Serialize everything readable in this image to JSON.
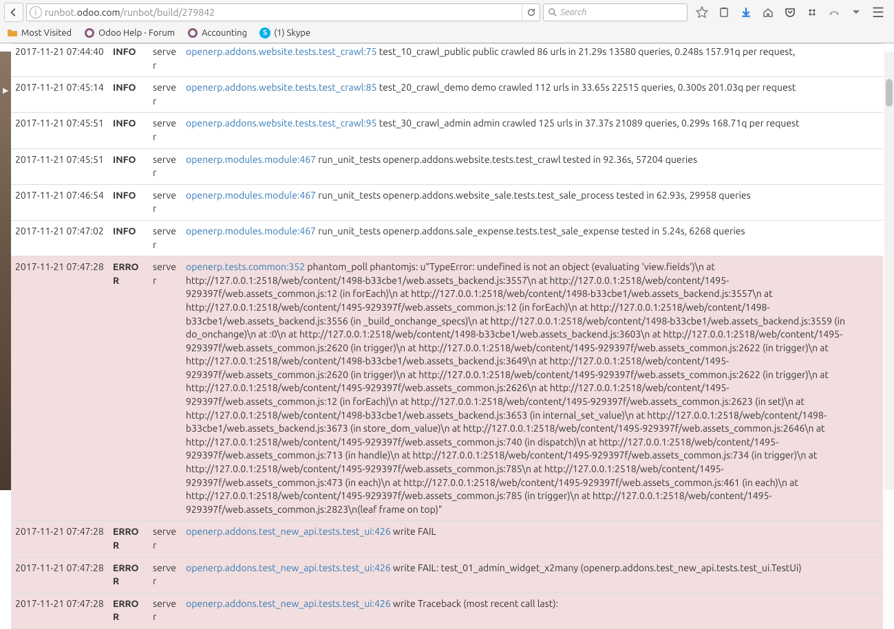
{
  "browser": {
    "url_prefix": "runbot.",
    "url_host": "odoo.com",
    "url_path": "/runbot/build/279842",
    "search_placeholder": "Search"
  },
  "bookmarks": [
    {
      "label": "Most Visited",
      "icon": "folder"
    },
    {
      "label": "Odoo Help - Forum",
      "icon": "ring"
    },
    {
      "label": "Accounting",
      "icon": "ring"
    },
    {
      "label": "(1) Skype",
      "icon": "skype"
    }
  ],
  "log_rows": [
    {
      "time": "2017-11-21 07:44:40",
      "level": "INFO",
      "src": "server",
      "link": "openerp.addons.website.tests.test_crawl:75",
      "text": "test_10_crawl_public public crawled 86 urls in 21.29s 13580 queries, 0.248s 157.91q per request,"
    },
    {
      "time": "2017-11-21 07:45:14",
      "level": "INFO",
      "src": "server",
      "link": "openerp.addons.website.tests.test_crawl:85",
      "text": "test_20_crawl_demo demo crawled 112 urls in 33.65s 22515 queries, 0.300s 201.03q per request"
    },
    {
      "time": "2017-11-21 07:45:51",
      "level": "INFO",
      "src": "server",
      "link": "openerp.addons.website.tests.test_crawl:95",
      "text": "test_30_crawl_admin admin crawled 125 urls in 37.37s 21089 queries, 0.299s 168.71q per request"
    },
    {
      "time": "2017-11-21 07:45:51",
      "level": "INFO",
      "src": "server",
      "link": "openerp.modules.module:467",
      "text": "run_unit_tests openerp.addons.website.tests.test_crawl tested in 92.36s, 57204 queries"
    },
    {
      "time": "2017-11-21 07:46:54",
      "level": "INFO",
      "src": "server",
      "link": "openerp.modules.module:467",
      "text": "run_unit_tests openerp.addons.website_sale.tests.test_sale_process tested in 62.93s, 29958 queries"
    },
    {
      "time": "2017-11-21 07:47:02",
      "level": "INFO",
      "src": "server",
      "link": "openerp.modules.module:467",
      "text": "run_unit_tests openerp.addons.sale_expense.tests.test_sale_expense tested in 5.24s, 6268 queries"
    },
    {
      "time": "2017-11-21 07:47:28",
      "level": "ERROR",
      "src": "server",
      "link": "openerp.tests.common:352",
      "text": "phantom_poll phantomjs: u\"TypeError: undefined is not an object (evaluating 'view.fields')\\n at http://127.0.0.1:2518/web/content/1498-b33cbe1/web.assets_backend.js:3557\\n at http://127.0.0.1:2518/web/content/1495-929397f/web.assets_common.js:12 (in forEach)\\n at http://127.0.0.1:2518/web/content/1498-b33cbe1/web.assets_backend.js:3557\\n at http://127.0.0.1:2518/web/content/1495-929397f/web.assets_common.js:12 (in forEach)\\n at http://127.0.0.1:2518/web/content/1498-b33cbe1/web.assets_backend.js:3556 (in _build_onchange_specs)\\n at http://127.0.0.1:2518/web/content/1498-b33cbe1/web.assets_backend.js:3559 (in do_onchange)\\n at :0\\n at http://127.0.0.1:2518/web/content/1498-b33cbe1/web.assets_backend.js:3603\\n at http://127.0.0.1:2518/web/content/1495-929397f/web.assets_common.js:2620 (in trigger)\\n at http://127.0.0.1:2518/web/content/1495-929397f/web.assets_common.js:2622 (in trigger)\\n at http://127.0.0.1:2518/web/content/1498-b33cbe1/web.assets_backend.js:3649\\n at http://127.0.0.1:2518/web/content/1495-929397f/web.assets_common.js:2620 (in trigger)\\n at http://127.0.0.1:2518/web/content/1495-929397f/web.assets_common.js:2622 (in trigger)\\n at http://127.0.0.1:2518/web/content/1495-929397f/web.assets_common.js:2626\\n at http://127.0.0.1:2518/web/content/1495-929397f/web.assets_common.js:12 (in forEach)\\n at http://127.0.0.1:2518/web/content/1495-929397f/web.assets_common.js:2623 (in set)\\n at http://127.0.0.1:2518/web/content/1498-b33cbe1/web.assets_backend.js:3653 (in internal_set_value)\\n at http://127.0.0.1:2518/web/content/1498-b33cbe1/web.assets_backend.js:3673 (in store_dom_value)\\n at http://127.0.0.1:2518/web/content/1495-929397f/web.assets_common.js:2646\\n at http://127.0.0.1:2518/web/content/1495-929397f/web.assets_common.js:740 (in dispatch)\\n at http://127.0.0.1:2518/web/content/1495-929397f/web.assets_common.js:713 (in handle)\\n at http://127.0.0.1:2518/web/content/1495-929397f/web.assets_common.js:734 (in trigger)\\n at http://127.0.0.1:2518/web/content/1495-929397f/web.assets_common.js:785\\n at http://127.0.0.1:2518/web/content/1495-929397f/web.assets_common.js:473 (in each)\\n at http://127.0.0.1:2518/web/content/1495-929397f/web.assets_common.js:461 (in each)\\n at http://127.0.0.1:2518/web/content/1495-929397f/web.assets_common.js:785 (in trigger)\\n at http://127.0.0.1:2518/web/content/1495-929397f/web.assets_common.js:2823\\n(leaf frame on top)\""
    },
    {
      "time": "2017-11-21 07:47:28",
      "level": "ERROR",
      "src": "server",
      "link": "openerp.addons.test_new_api.tests.test_ui:426",
      "text": "write FAIL"
    },
    {
      "time": "2017-11-21 07:47:28",
      "level": "ERROR",
      "src": "server",
      "link": "openerp.addons.test_new_api.tests.test_ui:426",
      "text": "write FAIL: test_01_admin_widget_x2many (openerp.addons.test_new_api.tests.test_ui.TestUi)"
    },
    {
      "time": "2017-11-21 07:47:28",
      "level": "ERROR",
      "src": "server",
      "link": "openerp.addons.test_new_api.tests.test_ui:426",
      "text": "write Traceback (most recent call last):"
    }
  ]
}
